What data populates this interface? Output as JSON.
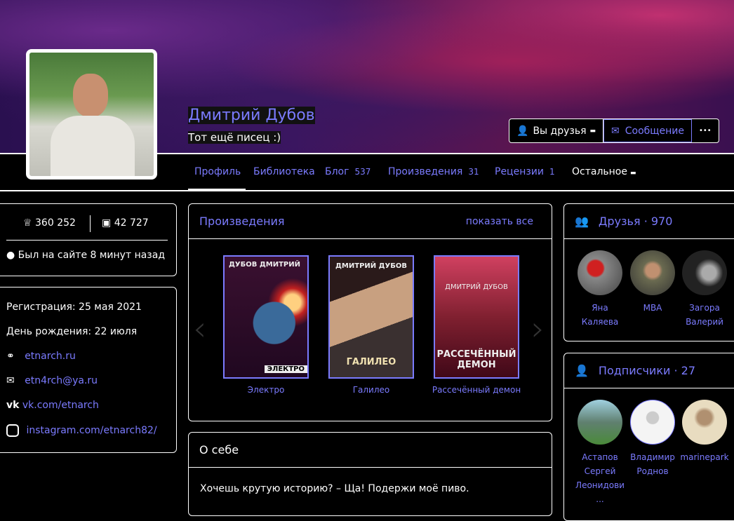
{
  "profile": {
    "name": "Дмитрий Дубов",
    "status": "Тот ещё писец :)"
  },
  "actions": {
    "friends": "Вы друзья",
    "message": "Сообщение",
    "more": "•••"
  },
  "nav": [
    {
      "label": "Профиль"
    },
    {
      "label": "Библиотека"
    },
    {
      "label": "Блог",
      "count": "537"
    },
    {
      "label": "Произведения",
      "count": "31"
    },
    {
      "label": "Рецензии",
      "count": "1"
    },
    {
      "label": "Остальное"
    }
  ],
  "stats": {
    "rating": "360 252",
    "readers": "42 727",
    "online": "Был на сайте 8 минут назад"
  },
  "info": {
    "registration": "Регистрация: 25 мая 2021",
    "birthday": "День рождения: 22 июля",
    "site": "etnarch.ru",
    "email": "etn4rch@ya.ru",
    "vk": "vk.com/etnarch",
    "instagram": "instagram.com/etnarch82/"
  },
  "works": {
    "title": "Произведения",
    "show_all": "показать все",
    "books": [
      {
        "title": "Электро",
        "cover_author": "ДУБОВ ДМИТРИЙ",
        "cover_title": "ЭЛЕКТРО"
      },
      {
        "title": "Галилео",
        "cover_author": "ДМИТРИЙ ДУБОВ",
        "cover_title": "ГАЛИЛЕО"
      },
      {
        "title": "Рассечённый демон",
        "cover_author": "ДМИТРИЙ ДУБОВ",
        "cover_title": "РАССЕЧЁННЫЙ ДЕМОН"
      }
    ]
  },
  "about": {
    "title": "О себе",
    "text": "Хочешь крутую историю? – Ща! Подержи моё пиво."
  },
  "friends": {
    "title": "Друзья",
    "count": "970",
    "items": [
      {
        "l1": "Яна",
        "l2": "Каляева"
      },
      {
        "l1": "MBA",
        "l2": ""
      },
      {
        "l1": "Загора",
        "l2": "Валерий"
      }
    ]
  },
  "subscribers": {
    "title": "Подписчики",
    "count": "27",
    "items": [
      {
        "l1": "Астапов",
        "l2": "Сергей",
        "l3": "Леонидови",
        "l4": "..."
      },
      {
        "l1": "Владимир",
        "l2": "Роднов"
      },
      {
        "l1": "marinepark"
      }
    ]
  },
  "colors": {
    "accent": "#7b7bff",
    "bg": "#000000"
  }
}
